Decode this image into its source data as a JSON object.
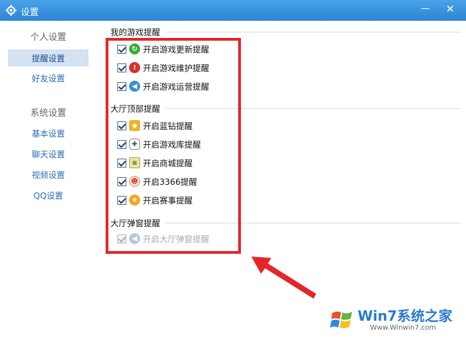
{
  "window": {
    "title": "设置",
    "min_glyph": "—",
    "close_glyph": "✕"
  },
  "sidebar": {
    "groups": [
      {
        "label": "个人设置",
        "items": [
          {
            "label": "提醒设置",
            "active": true
          },
          {
            "label": "好友设置",
            "active": false
          }
        ]
      },
      {
        "label": "系统设置",
        "items": [
          {
            "label": "基本设置",
            "active": false
          },
          {
            "label": "聊天设置",
            "active": false
          },
          {
            "label": "视频设置",
            "active": false
          },
          {
            "label": "QQ设置",
            "active": false
          }
        ]
      }
    ]
  },
  "sections": [
    {
      "title": "我的游戏提醒",
      "options": [
        {
          "label": "开启游戏更新提醒",
          "checked": true,
          "disabled": false,
          "icon": "update-icon"
        },
        {
          "label": "开启游戏维护提醒",
          "checked": true,
          "disabled": false,
          "icon": "alert-icon"
        },
        {
          "label": "开启游戏运营提醒",
          "checked": true,
          "disabled": false,
          "icon": "speaker-icon"
        }
      ]
    },
    {
      "title": "大厅顶部提醒",
      "options": [
        {
          "label": "开启蓝钻提醒",
          "checked": true,
          "disabled": false,
          "icon": "blue-diamond-icon"
        },
        {
          "label": "开启游戏库提醒",
          "checked": true,
          "disabled": false,
          "icon": "gamepad-icon"
        },
        {
          "label": "开启商城提醒",
          "checked": true,
          "disabled": false,
          "icon": "shop-icon"
        },
        {
          "label": "开启3366提醒",
          "checked": true,
          "disabled": false,
          "icon": "3366-icon"
        },
        {
          "label": "开启赛事提醒",
          "checked": true,
          "disabled": false,
          "icon": "trophy-icon"
        }
      ]
    },
    {
      "title": "大厅弹窗提醒",
      "options": [
        {
          "label": "开启大厅弹窗提醒",
          "checked": true,
          "disabled": true,
          "icon": "speaker-icon"
        }
      ]
    }
  ],
  "watermark": {
    "brand": "Win7系统之家",
    "url": "Www.Winwin7.com"
  },
  "colors": {
    "titlebar": "#2c86d4",
    "highlight_box": "#e4262b",
    "sidebar_active": "#d4e3f4",
    "link": "#2a6cb7"
  }
}
